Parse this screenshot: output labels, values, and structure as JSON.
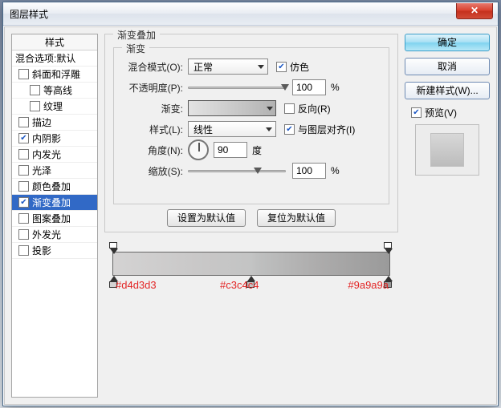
{
  "window": {
    "title": "图层样式"
  },
  "sidebar": {
    "header": "样式",
    "blendingDefaults": "混合选项:默认",
    "items": [
      {
        "label": "斜面和浮雕",
        "checked": false,
        "indent": false
      },
      {
        "label": "等高线",
        "checked": false,
        "indent": true
      },
      {
        "label": "纹理",
        "checked": false,
        "indent": true
      },
      {
        "label": "描边",
        "checked": false,
        "indent": false
      },
      {
        "label": "内阴影",
        "checked": true,
        "indent": false
      },
      {
        "label": "内发光",
        "checked": false,
        "indent": false
      },
      {
        "label": "光泽",
        "checked": false,
        "indent": false
      },
      {
        "label": "颜色叠加",
        "checked": false,
        "indent": false
      },
      {
        "label": "渐变叠加",
        "checked": true,
        "indent": false,
        "selected": true
      },
      {
        "label": "图案叠加",
        "checked": false,
        "indent": false
      },
      {
        "label": "外发光",
        "checked": false,
        "indent": false
      },
      {
        "label": "投影",
        "checked": false,
        "indent": false
      }
    ]
  },
  "panel": {
    "title": "渐变叠加",
    "groupTitle": "渐变",
    "blendMode": {
      "label": "混合模式(O):",
      "value": "正常"
    },
    "dither": {
      "label": "仿色",
      "checked": true
    },
    "opacity": {
      "label": "不透明度(P):",
      "value": "100",
      "unit": "%"
    },
    "gradient": {
      "label": "渐变:"
    },
    "reverse": {
      "label": "反向(R)",
      "checked": false
    },
    "style": {
      "label": "样式(L):",
      "value": "线性"
    },
    "align": {
      "label": "与图层对齐(I)",
      "checked": true
    },
    "angle": {
      "label": "角度(N):",
      "value": "90",
      "unit": "度"
    },
    "scale": {
      "label": "缩放(S):",
      "value": "100",
      "unit": "%"
    },
    "btnDefault": "设置为默认值",
    "btnReset": "复位为默认值"
  },
  "gradient_stops": {
    "annotations": [
      "#d4d3d3",
      "#c3c4c4",
      "#9a9a9a"
    ]
  },
  "right": {
    "ok": "确定",
    "cancel": "取消",
    "newStyle": "新建样式(W)...",
    "preview": {
      "label": "预览(V)",
      "checked": true
    }
  }
}
